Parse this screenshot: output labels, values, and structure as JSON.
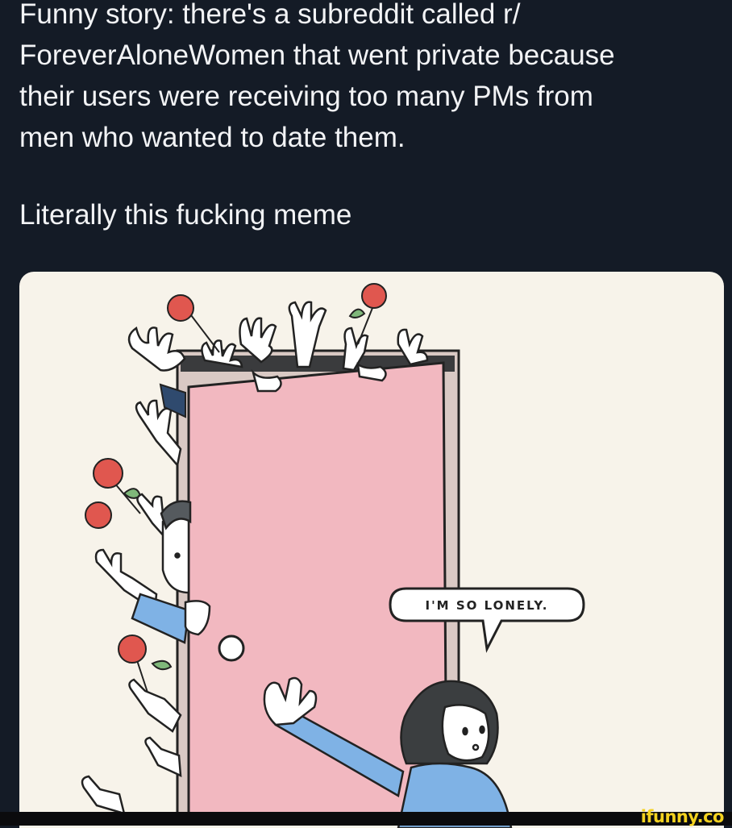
{
  "post": {
    "lines": [
      "Funny story: there's a subreddit called r/",
      "ForeverAloneWomen that went private because",
      "their users were receiving too many PMs from",
      "men who wanted to date them."
    ],
    "second_paragraph": "Literally this fucking meme"
  },
  "comic": {
    "speech_bubble": "I'M SO LONELY.",
    "colors": {
      "door": "#f2b8c0",
      "flower": "#e0574f",
      "leaf": "#7fb87a",
      "shirt": "#7fb2e5"
    }
  },
  "watermark": "ifunny.co"
}
